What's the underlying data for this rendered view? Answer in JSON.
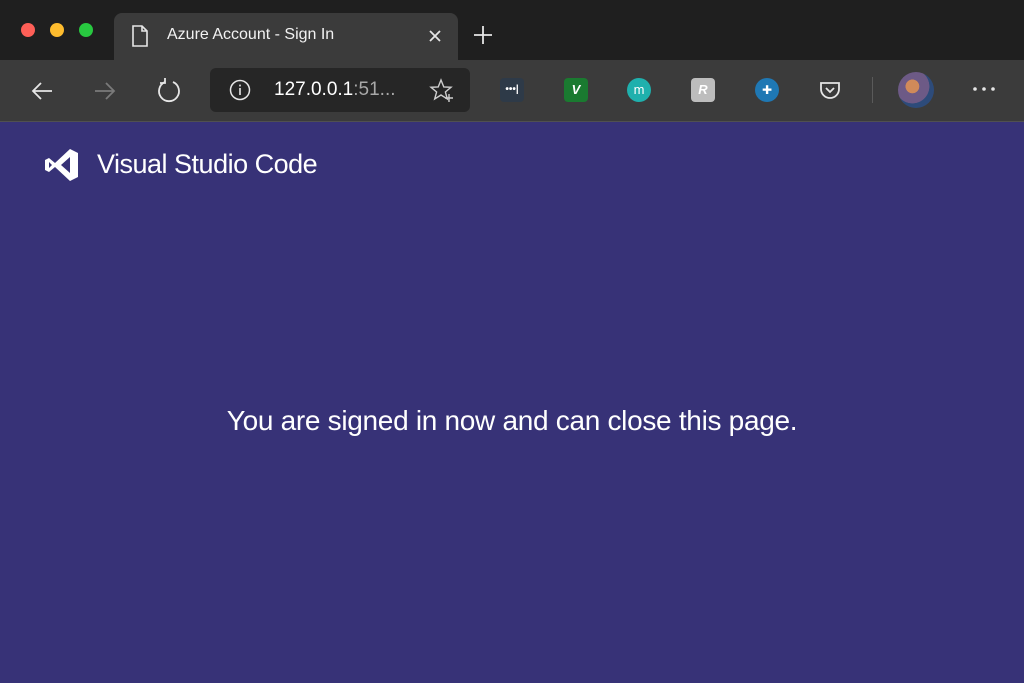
{
  "colors": {
    "content_background": "#373277",
    "tabstrip": "#1f1f1f",
    "toolbar": "#3b3b3b",
    "addressbar": "#262626"
  },
  "tab": {
    "title": "Azure Account - Sign In",
    "icon": "page-icon"
  },
  "addressbar": {
    "url_host": "127.0.0.1",
    "url_rest": ":51..."
  },
  "extensions": [
    {
      "name": "ellipsis-extension-icon",
      "text": "•••|"
    },
    {
      "name": "v-extension-icon",
      "text": "V"
    },
    {
      "name": "m-extension-icon",
      "text": "m"
    },
    {
      "name": "script-extension-icon",
      "text": "R"
    },
    {
      "name": "crossplus-extension-icon",
      "text": "✚"
    },
    {
      "name": "pocket-icon",
      "text": ""
    }
  ],
  "page": {
    "brand": "Visual Studio Code",
    "message": "You are signed in now and can close this page."
  }
}
